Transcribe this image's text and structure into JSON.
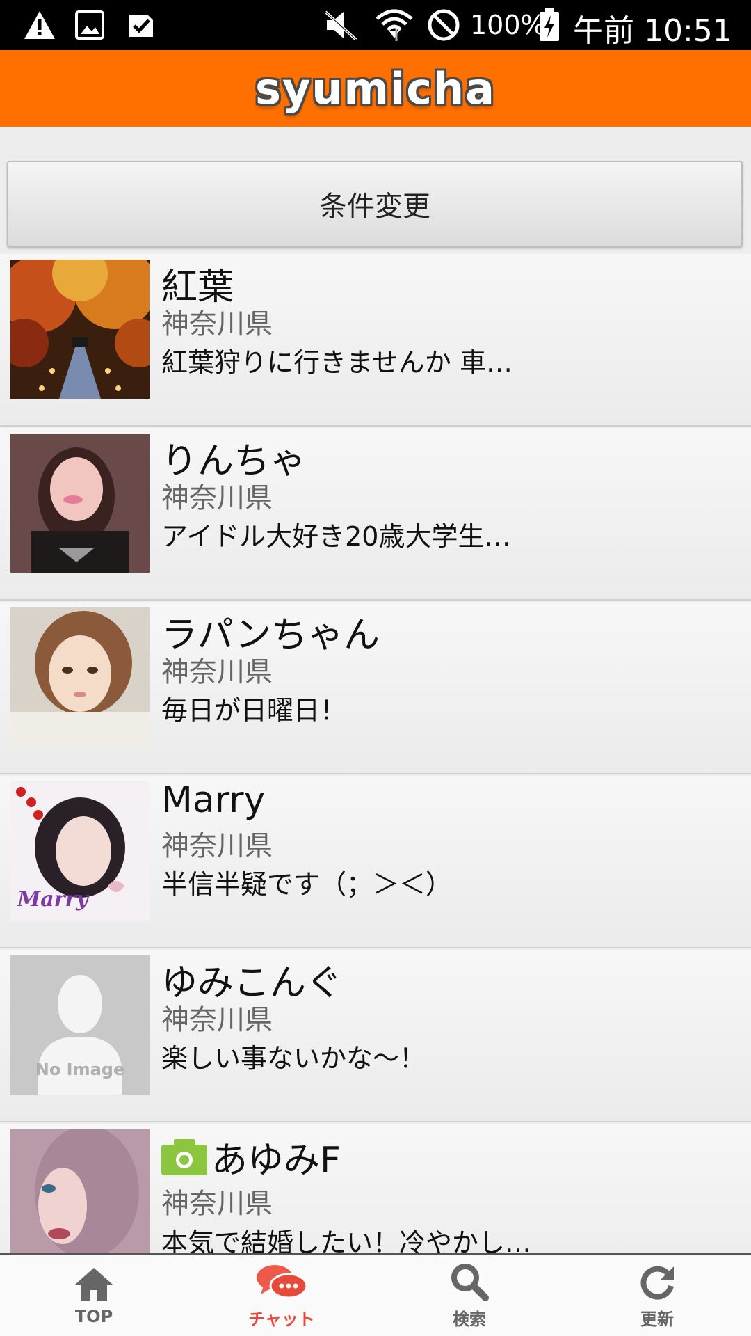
{
  "status_bar": {
    "battery": "100%",
    "time": "午前 10:51",
    "icons": [
      "warning-icon",
      "image-icon",
      "task-icon",
      "mute-icon",
      "wifi-icon",
      "do-not-disturb-icon",
      "battery-charging-icon"
    ]
  },
  "header": {
    "logo": "syumicha",
    "color": "#ff7000"
  },
  "filter_button": {
    "label": "条件変更"
  },
  "list": {
    "items": [
      {
        "name": "紅葉",
        "prefecture": "神奈川県",
        "message": "紅葉狩りに行きませんか 車…",
        "avatar": "autumn-leaves-photo"
      },
      {
        "name": "りんちゃ",
        "prefecture": "神奈川県",
        "message": "アイドル大好き20歳大学生…",
        "avatar": "profile-photo"
      },
      {
        "name": "ラパンちゃん",
        "prefecture": "神奈川県",
        "message": "毎日が日曜日！",
        "avatar": "profile-photo"
      },
      {
        "name": "Marry",
        "prefecture": "神奈川県",
        "message": "半信半疑です（；＞＜）",
        "avatar": "profile-photo",
        "avatar_caption": "Marry"
      },
      {
        "name": "ゆみこんぐ",
        "prefecture": "神奈川県",
        "message": "楽しい事ないかな～！",
        "avatar": "no-image-placeholder",
        "avatar_caption": "No Image"
      },
      {
        "name": "あゆみF",
        "prefecture": "神奈川県",
        "message": "本気で結婚したい！冷やかし…",
        "avatar": "profile-photo",
        "badge": "camera-icon"
      }
    ]
  },
  "tab_bar": {
    "tabs": [
      {
        "label": "TOP",
        "icon": "home-icon"
      },
      {
        "label": "チャット",
        "icon": "chat-icon",
        "active": true
      },
      {
        "label": "検索",
        "icon": "search-icon"
      },
      {
        "label": "更新",
        "icon": "refresh-icon"
      }
    ],
    "active_color": "#e84a3a"
  }
}
